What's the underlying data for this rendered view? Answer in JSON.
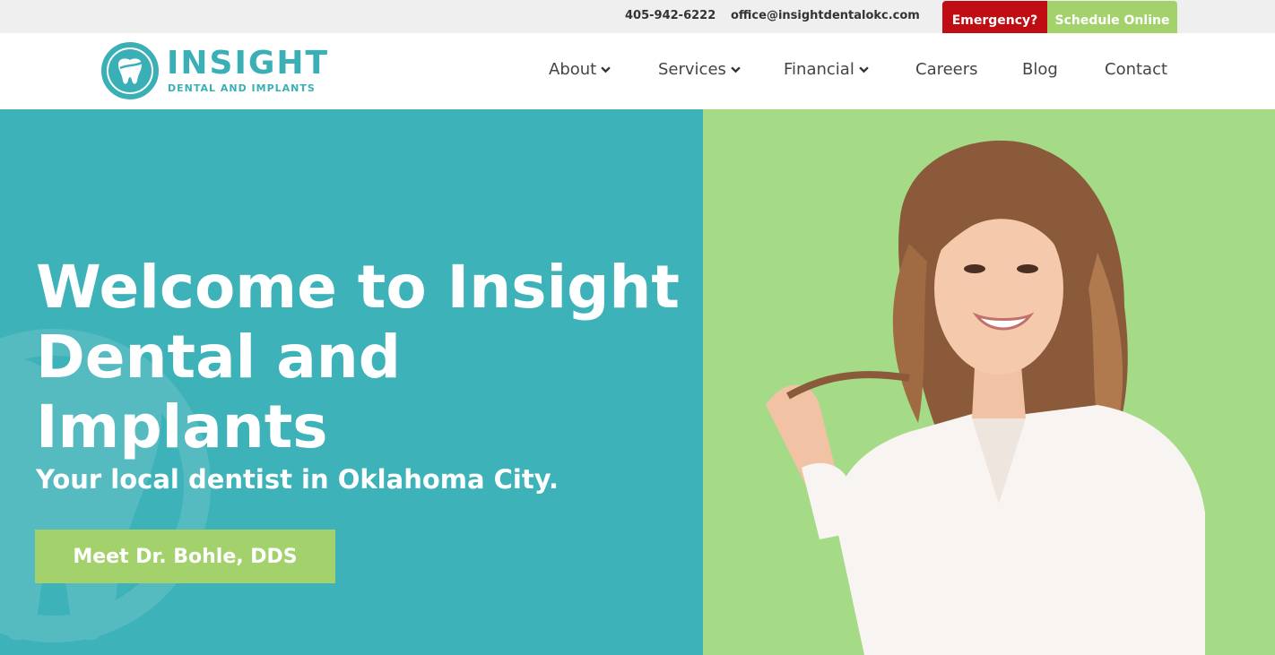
{
  "topbar": {
    "phone": "405-942-6222",
    "email": "office@insightdentalokc.com",
    "emergency_label": "Emergency?",
    "schedule_label": "Schedule Online"
  },
  "logo": {
    "name": "INSIGHT",
    "tagline": "DENTAL AND IMPLANTS"
  },
  "nav": {
    "items": [
      {
        "label": "About",
        "dropdown": true
      },
      {
        "label": "Services",
        "dropdown": true
      },
      {
        "label": "Financial",
        "dropdown": true
      },
      {
        "label": "Careers",
        "dropdown": false
      },
      {
        "label": "Blog",
        "dropdown": false
      },
      {
        "label": "Contact",
        "dropdown": false
      }
    ]
  },
  "hero": {
    "title": "Welcome to Insight Dental and Implants",
    "subtitle": "Your local dentist in Oklahoma City.",
    "cta_label": "Meet Dr. Bohle, DDS",
    "photo_icon": "smiling-woman-photo"
  },
  "colors": {
    "teal": "#3db2b8",
    "green": "#a3d16b",
    "red": "#c00d14"
  }
}
